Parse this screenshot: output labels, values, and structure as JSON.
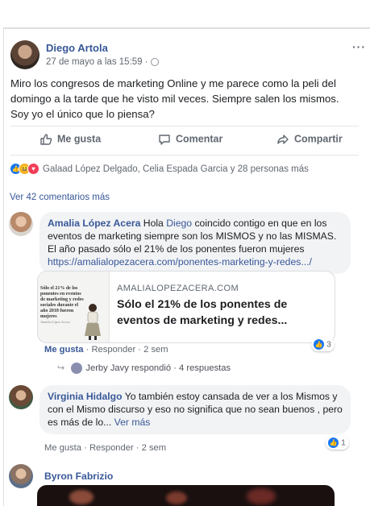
{
  "post": {
    "author": "Diego Artola",
    "timestamp": "27 de mayo a las 15:59 ·",
    "text": "Miro los congresos de marketing Online y me parece como la peli del domingo a la tarde que he visto mil veces. Siempre salen los mismos. Soy yo el único que lo piensa?",
    "more_label": "···"
  },
  "actions": {
    "like": "Me gusta",
    "comment": "Comentar",
    "share": "Compartir"
  },
  "reactions": {
    "summary": "Galaad López Delgado, Celia Espada Garcia y 28 personas más",
    "types": [
      "like-icon",
      "haha-icon",
      "love-icon"
    ]
  },
  "view_more_comments": "Ver 42 comentarios más",
  "comments": [
    {
      "author": "Amalia López Acera",
      "text_pre": " Hola ",
      "mention": "Diego",
      "text_post": " coincido contigo en que en los eventos de marketing siempre son los MISMOS y no las MISMAS. El año pasado sólo el 21% de los ponentes fueron mujeres",
      "link": "https://amalialopezacera.com/ponentes-marketing-y-redes.../",
      "preview": {
        "domain": "AMALIALOPEZACERA.COM",
        "title": "Sólo el 21% de los ponentes de eventos de marketing y redes...",
        "thumb_text": "Sólo el 21% de los ponentes en eventos de marketing y redes sociales durante el año 2018 fueron mujeres",
        "thumb_sig": "Amalia López Acera"
      },
      "meta_like": "Me gusta",
      "meta_rest": " · Responder · 2 sem",
      "reaction_count": "3",
      "reply_line": "Jerby Javy respondió · 4 respuestas"
    },
    {
      "author": "Virginia Hidalgo",
      "text": " Yo también estoy cansada de ver a los Mismos y con el Mismo discurso y eso no significa que no sean buenos , pero es más de lo...",
      "see_more": " Ver más",
      "meta": "Me gusta · Responder · 2 sem",
      "reaction_count": "1"
    },
    {
      "author": "Byron Fabrizio"
    }
  ],
  "colors": {
    "link": "#385898",
    "bubble": "#f2f3f5",
    "like_blue": "#1877f2"
  }
}
